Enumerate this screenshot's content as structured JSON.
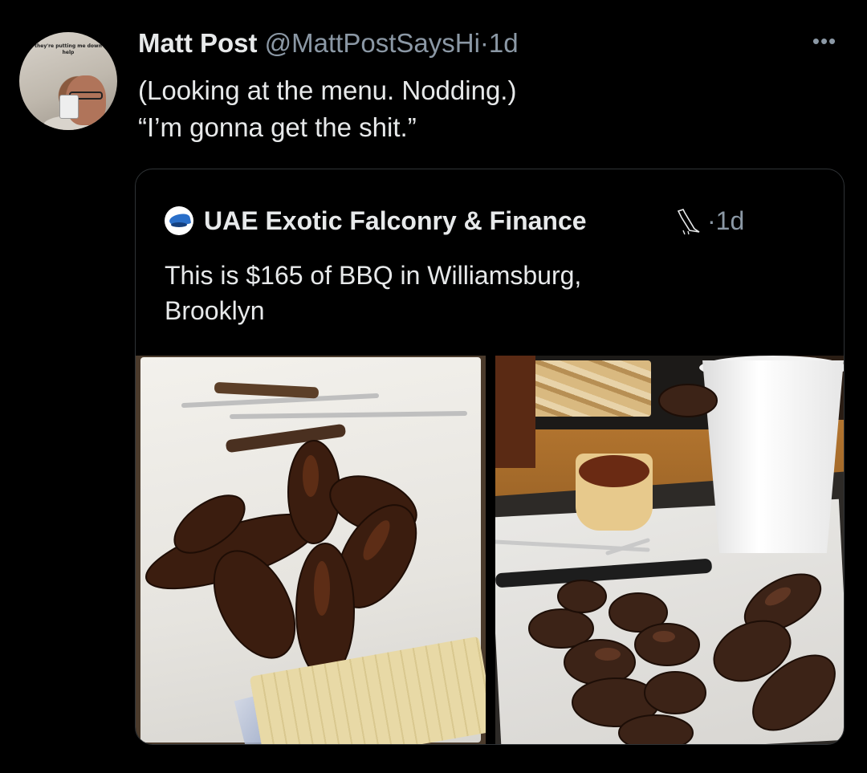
{
  "tweet": {
    "author_name": "Matt Post",
    "handle": "@MattPostSaysHi",
    "separator": "·",
    "time": "1d",
    "more_icon": "more-horizontal-icon",
    "more_glyph": "•••",
    "avatar_banner": "they're putting me down help",
    "lines": [
      "(Looking at the menu. Nodding.)",
      "“I’m gonna get the shit.”"
    ]
  },
  "quote": {
    "author_name": "UAE Exotic Falconry & Finance",
    "avatar_icon": "falcon-logo-icon",
    "badge_icon": "falcon-emoji-icon",
    "separator": "·",
    "time": "1d",
    "lines": [
      "This is $165 of BBQ in Williamsburg,",
      "Brooklyn"
    ],
    "media": [
      {
        "name": "bbq-photo-sausages-on-paper"
      },
      {
        "name": "bbq-photo-tray-with-cup"
      }
    ]
  },
  "colors": {
    "background": "#000000",
    "text": "#e7e9ea",
    "muted": "#8b98a5",
    "border": "#2f3336"
  }
}
